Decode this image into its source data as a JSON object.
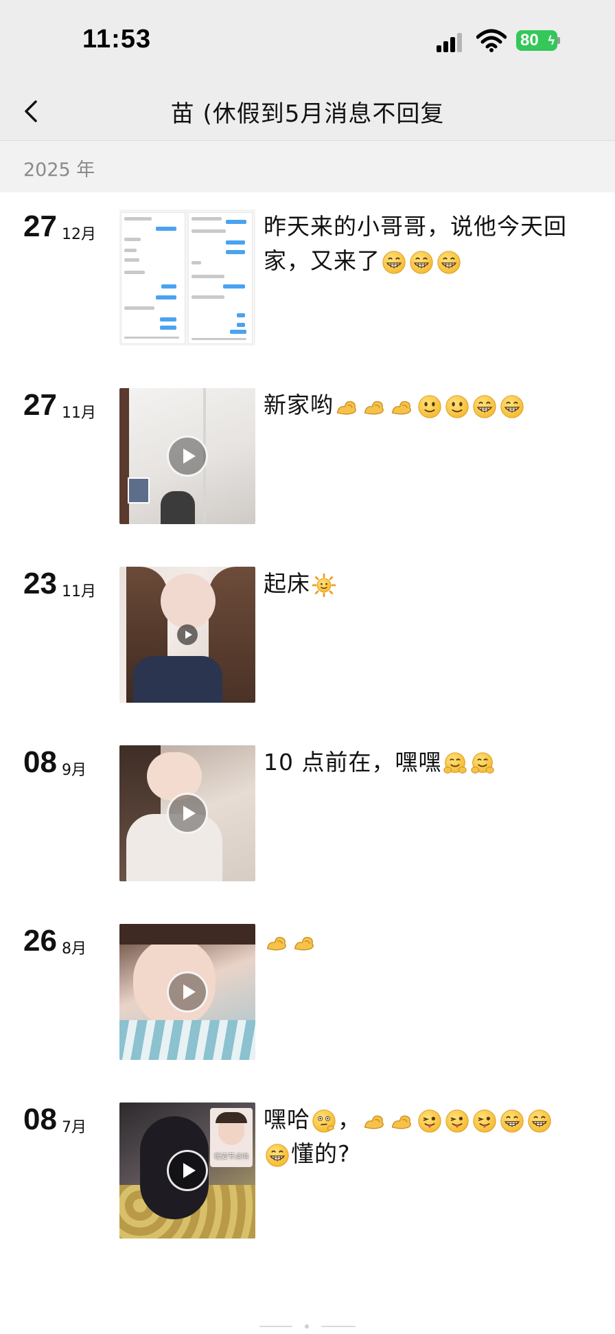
{
  "status_bar": {
    "time": "11:53",
    "battery": "80"
  },
  "nav": {
    "title": "苗 (休假到5月消息不回复"
  },
  "year_header": "2025 年",
  "posts": [
    {
      "day": "27",
      "month": "12月",
      "text": "昨天来的小哥哥，说他今天回家，又来了",
      "emojis": [
        "grin-emoji",
        "grin-emoji",
        "grin-emoji"
      ]
    },
    {
      "day": "27",
      "month": "11月",
      "text": "新家哟",
      "emojis": [
        "strong-arm-emoji",
        "strong-arm-emoji",
        "strong-arm-emoji",
        "smile-emoji",
        "smile-emoji",
        "grin-emoji",
        "grin-emoji"
      ]
    },
    {
      "day": "23",
      "month": "11月",
      "text": "起床",
      "emojis": [
        "sun-emoji"
      ]
    },
    {
      "day": "08",
      "month": "9月",
      "text": "10 点前在，嘿嘿",
      "emojis": [
        "hug-emoji",
        "hug-emoji"
      ]
    },
    {
      "day": "26",
      "month": "8月",
      "text": "",
      "emojis": [
        "strong-arm-emoji",
        "strong-arm-emoji"
      ]
    },
    {
      "day": "08",
      "month": "7月",
      "text_before": "嘿哈",
      "text_mid": "，",
      "text_after": "懂的?",
      "thumb_caption": "暖姿节点响",
      "emojis_a": [
        "thinking-emoji"
      ],
      "emojis_b": [
        "strong-arm-emoji",
        "strong-arm-emoji",
        "wink-tongue-emoji",
        "wink-tongue-emoji",
        "wink-tongue-emoji",
        "grin-emoji",
        "grin-emoji",
        "grin-emoji"
      ]
    }
  ],
  "colors": {
    "status_bg": "#ededed",
    "battery_green": "#34c759",
    "year_bg": "#f2f2f2",
    "chat_blue": "#4aa3f0"
  }
}
